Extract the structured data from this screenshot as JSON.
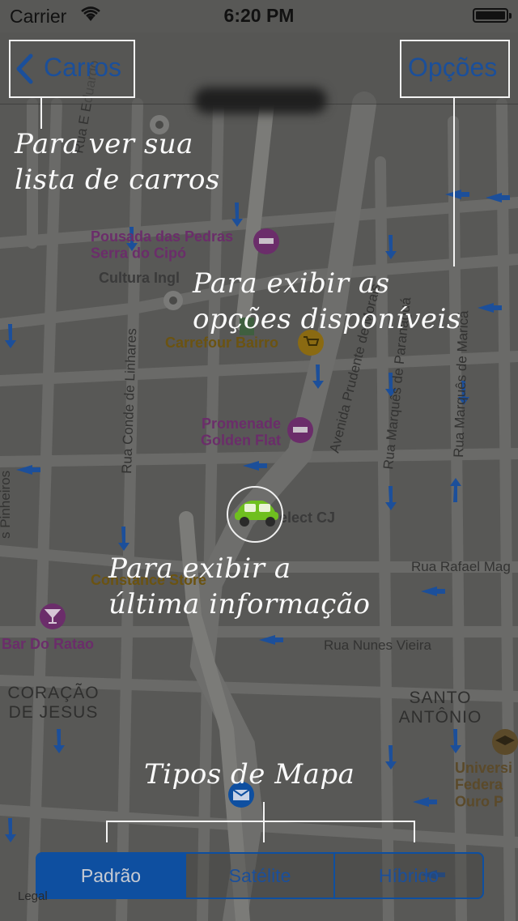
{
  "status_bar": {
    "carrier": "Carrier",
    "time": "6:20 PM",
    "battery_level": 1.0
  },
  "nav": {
    "back_label": "Carros",
    "options_label": "Opções"
  },
  "annotations": {
    "back": "Para ver sua\nlista de carros",
    "options": "Para exibir as\nopções disponíveis",
    "car": "Para exibir a\núltima informação",
    "map_types": "Tipos de Mapa"
  },
  "map": {
    "pois": [
      {
        "name": "Pousada das Pedras\nSerra do Cipó",
        "type": "hotel",
        "color": "#6b2d6a"
      },
      {
        "name": "Cultura Ingl",
        "type": "landmark",
        "color": "#3a3a3a"
      },
      {
        "name": "Carrefour Bairro",
        "type": "shopping",
        "color": "#6b5311"
      },
      {
        "name": "Promenade\nGolden Flat",
        "type": "hotel",
        "color": "#6b2d6a"
      },
      {
        "name": "elect CJ",
        "type": "landmark",
        "color": "#3a3a3a"
      },
      {
        "name": "Constance Store",
        "type": "shopping",
        "color": "#6b5311"
      },
      {
        "name": "Bar Do Ratao",
        "type": "bar",
        "color": "#6b2d6a"
      },
      {
        "name": "Universi\nFedera\nOuro P",
        "type": "education",
        "color": "#5b4a2a"
      }
    ],
    "streets": [
      "Rua Conde de Linhares",
      "Avenida Prudente de Morais",
      "Rua Marquês de Paranaguá",
      "Rua Marquês de Maricá",
      "Rua Rafael Mag",
      "Rua Nunes Vieira",
      "Rua E Eduardo",
      "s Pinheiros"
    ],
    "districts": [
      "CORAÇÃO\nDE JESUS",
      "SANTO\nANTÔNIO"
    ]
  },
  "map_types": {
    "items": [
      "Padrão",
      "Satélite",
      "Híbrido"
    ],
    "selected": 0
  },
  "legal": "Legal"
}
